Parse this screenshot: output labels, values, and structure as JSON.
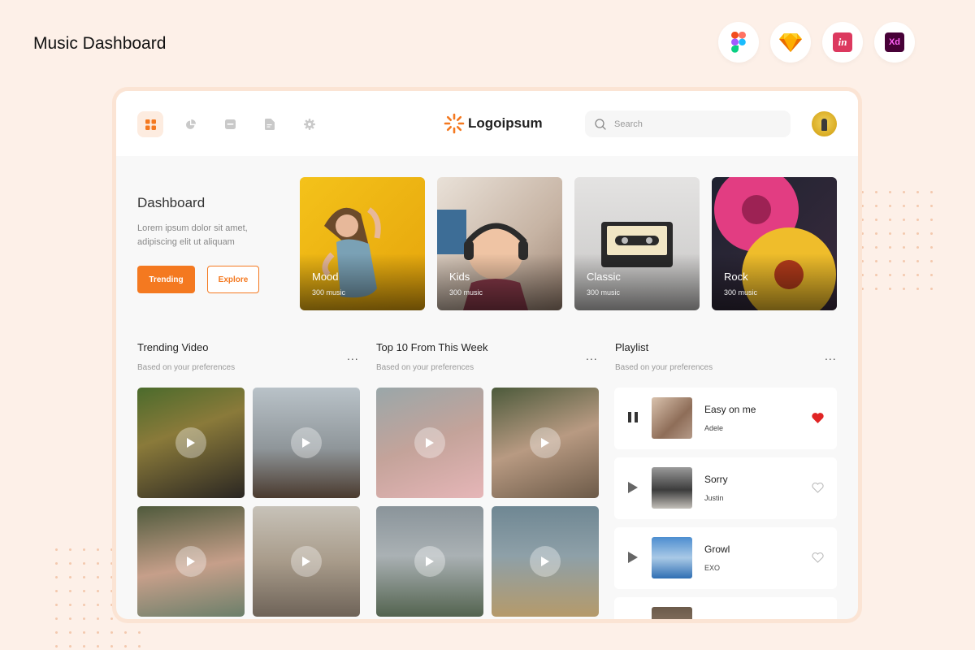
{
  "page_title": "Music Dashboard",
  "tool_icons": [
    "figma-icon",
    "sketch-icon",
    "invision-icon",
    "xd-icon"
  ],
  "tool_labels": {
    "invision": "in",
    "xd": "Xd"
  },
  "nav": [
    "dashboard-icon",
    "pie-chart-icon",
    "wallet-icon",
    "document-icon",
    "settings-icon"
  ],
  "logo": {
    "text": "Logoipsum"
  },
  "search": {
    "placeholder": "Search"
  },
  "intro": {
    "title": "Dashboard",
    "description": "Lorem ipsum dolor sit amet, adipiscing elit ut aliquam",
    "primary_button": "Trending",
    "secondary_button": "Explore"
  },
  "genres": [
    {
      "name": "Mood",
      "count": "300 music"
    },
    {
      "name": "Kids",
      "count": "300 music"
    },
    {
      "name": "Classic",
      "count": "300 music"
    },
    {
      "name": "Rock",
      "count": "300 music"
    }
  ],
  "trending": {
    "title": "Trending Video",
    "subtitle": "Based on your preferences",
    "more": "..."
  },
  "top10": {
    "title": "Top 10 From This Week",
    "subtitle": "Based on your preferences",
    "more": "..."
  },
  "playlist": {
    "title": "Playlist",
    "subtitle": "Based on your preferences",
    "more": "...",
    "tracks": [
      {
        "title": "Easy on me",
        "artist": "Adele",
        "state": "playing",
        "liked": true
      },
      {
        "title": "Sorry",
        "artist": "Justin",
        "state": "paused",
        "liked": false
      },
      {
        "title": "Growl",
        "artist": "EXO",
        "state": "paused",
        "liked": false
      }
    ]
  },
  "colors": {
    "accent": "#f47920",
    "background": "#fdf0e8",
    "heart": "#e02424"
  }
}
